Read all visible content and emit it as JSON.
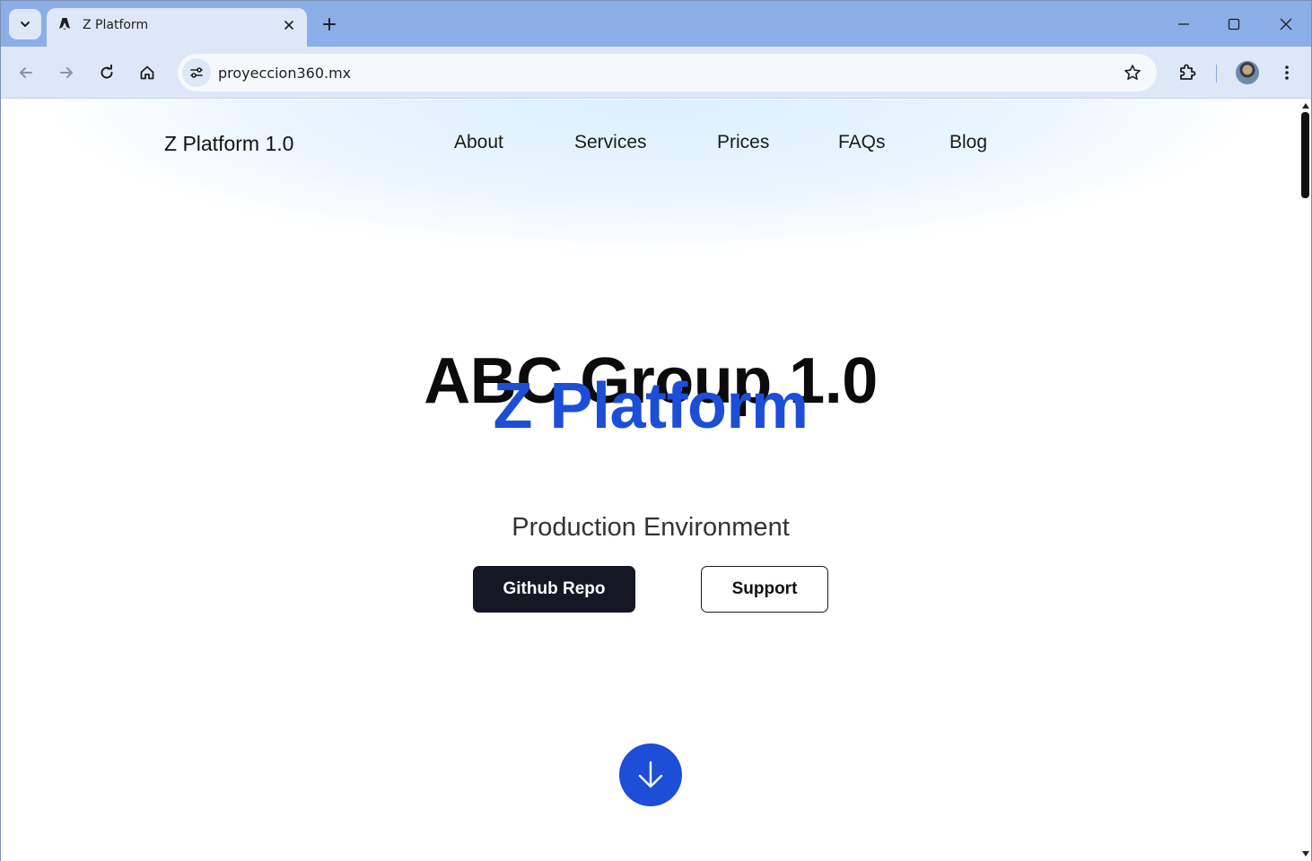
{
  "browser": {
    "tab_title": "Z Platform",
    "url": "proyeccion360.mx",
    "icons": {
      "tab_search": "chevron-down-icon",
      "favicon": "astro-logo-icon",
      "tab_close": "close-icon",
      "new_tab": "plus-icon",
      "back": "arrow-left-icon",
      "forward": "arrow-right-icon",
      "reload": "reload-icon",
      "home": "home-icon",
      "site_info": "tune-icon",
      "bookmark": "star-icon",
      "extensions": "puzzle-icon",
      "menu": "kebab-menu-icon"
    }
  },
  "site": {
    "brand": "Z Platform 1.0",
    "nav": [
      "About",
      "Services",
      "Prices",
      "FAQs",
      "Blog"
    ],
    "hero": {
      "line1": "ABC Group 1.0",
      "line2": "Z Platform",
      "subtitle": "Production Environment"
    },
    "buttons": {
      "primary": "Github Repo",
      "secondary": "Support"
    }
  },
  "colors": {
    "accent": "#1d4ed8",
    "primary_button": "#161724",
    "titlebar": "#8caee8",
    "toolbar": "#dde7f8"
  }
}
